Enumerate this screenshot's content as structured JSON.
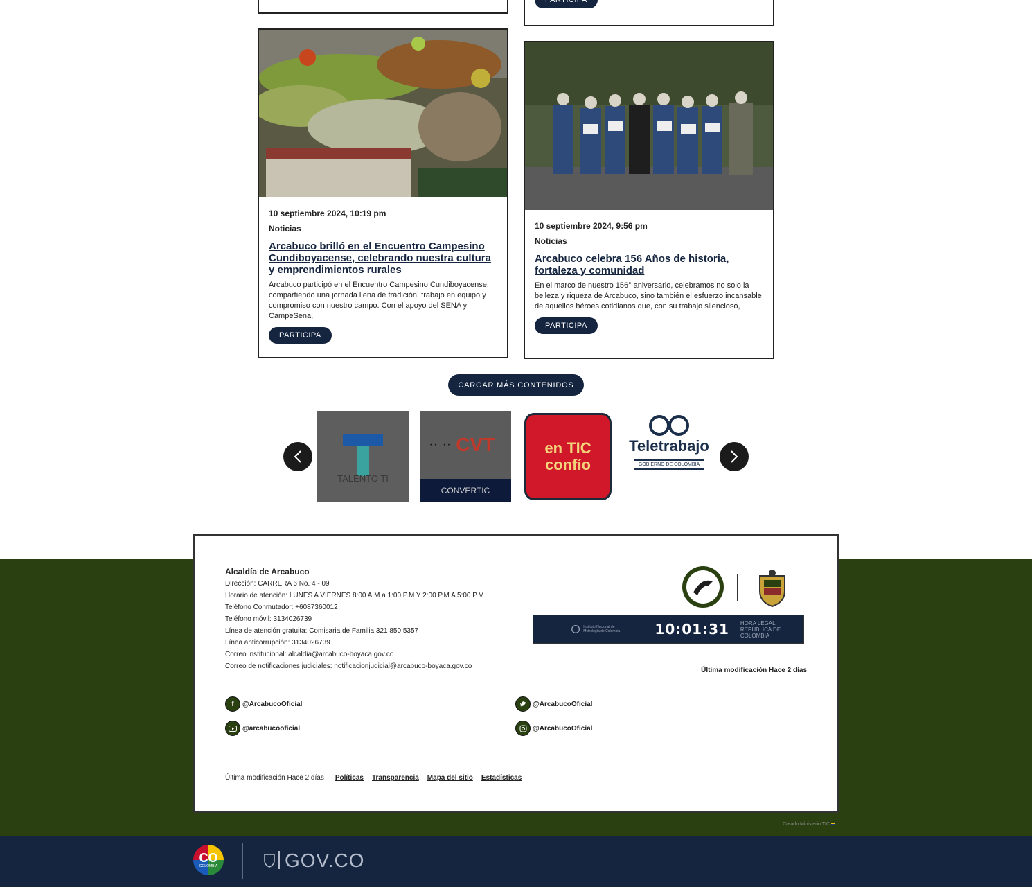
{
  "cards": [
    {
      "date": "10 septiembre 2024, 10:19 pm",
      "category": "Noticias",
      "title": "Arcabuco brilló en el Encuentro Campesino Cundiboyacense, celebrando nuestra cultura y emprendimientos rurales",
      "description": "Arcabuco participó en el Encuentro Campesino Cundiboyacense, compartiendo una jornada llena de tradición, trabajo en equipo y compromiso con nuestro campo. Con el apoyo del SENA y CampeSena,",
      "button": "PARTICIPA"
    },
    {
      "date": "10 septiembre 2024, 9:56 pm",
      "category": "Noticias",
      "title": "Arcabuco celebra 156 Años de historia, fortaleza y comunidad",
      "description": "En el marco de nuestro 156° aniversario, celebramos no solo la belleza y riqueza de Arcabuco, sino también el esfuerzo incansable de aquellos héroes cotidianos que, con su trabajo silencioso,",
      "button": "PARTICIPA"
    }
  ],
  "top_button": "PARTICIPA",
  "load_more": "CARGAR MÁS CONTENIDOS",
  "carousel": {
    "logos": [
      {
        "name": "talento-ti-logo",
        "text": "TALENTO TI"
      },
      {
        "name": "convertic-logo",
        "text": "CONVERTIC",
        "mark": "CVT"
      },
      {
        "name": "en-tic-confio-logo",
        "line1": "en TIC",
        "line2": "confío"
      },
      {
        "name": "teletrabajo-logo",
        "text": "Teletrabajo",
        "sub": "GOBIERNO DE COLOMBIA"
      }
    ]
  },
  "footer": {
    "title": "Alcaldía de Arcabuco",
    "lines": [
      "Dirección: CARRERA 6 No. 4 - 09",
      "Horario de atención: LUNES A VIERNES 8:00 A.M a 1:00 P.M Y 2:00 P.M A 5:00 P.M",
      "Teléfono Conmutador: +6087360012",
      "Teléfono móvil: 3134026739",
      "Línea de atención gratuita: Comisaria de Familia 321 850 5357",
      "Línea anticorrupción: 3134026739",
      "Correo institucional: alcaldia@arcabuco-boyaca.gov.co",
      "Correo de notificaciones judiciales: notificacionjudicial@arcabuco-boyaca.gov.co"
    ],
    "clock": {
      "institution": "Instituto Nacional de Metrología de Colombia",
      "time": "10:01:31",
      "label_line1": "HORA LEGAL",
      "label_line2": "REPÚBLICA DE COLOMBIA"
    },
    "last_modified_right": "Última modificación Hace 2 días",
    "social": {
      "facebook": "@ArcabucoOficial",
      "twitter": "@ArcabucoOficial",
      "youtube": "@arcabucooficial",
      "instagram": "@ArcabucoOficial"
    },
    "last_modified": "Última modificación Hace 2 días",
    "links": [
      "Políticas",
      "Transparencia",
      "Mapa del sitio",
      "Estadísticas"
    ],
    "created_by": "Creado Ministerio TIC"
  },
  "govbar": {
    "co_text": "CO",
    "co_sub": "COLOMBIA",
    "gov_text": "GOV.CO"
  },
  "colors": {
    "navy": "#15253f",
    "green": "#2a4010",
    "entic_red": "#d1182b"
  }
}
